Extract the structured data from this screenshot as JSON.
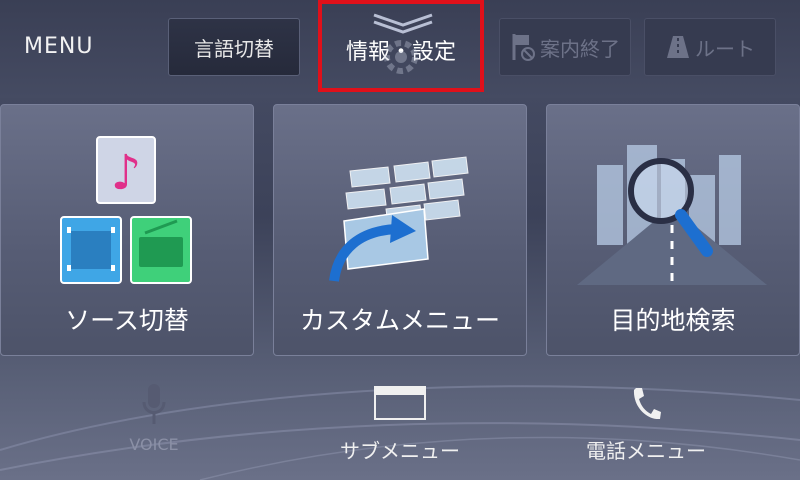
{
  "header": {
    "menu_label": "MENU",
    "language_button": "言語切替",
    "info_settings_button": "情報・設定",
    "end_guidance_button": "案内終了",
    "route_button": "ルート"
  },
  "tiles": [
    {
      "label": "ソース切替"
    },
    {
      "label": "カスタムメニュー"
    },
    {
      "label": "目的地検索"
    }
  ],
  "bottom": {
    "voice_label": "VOICE",
    "submenu_label": "サブメニュー",
    "phone_menu_label": "電話メニュー"
  },
  "colors": {
    "highlight_border": "#e0101a",
    "background": "#3c4259",
    "tile": "#5c627a"
  }
}
